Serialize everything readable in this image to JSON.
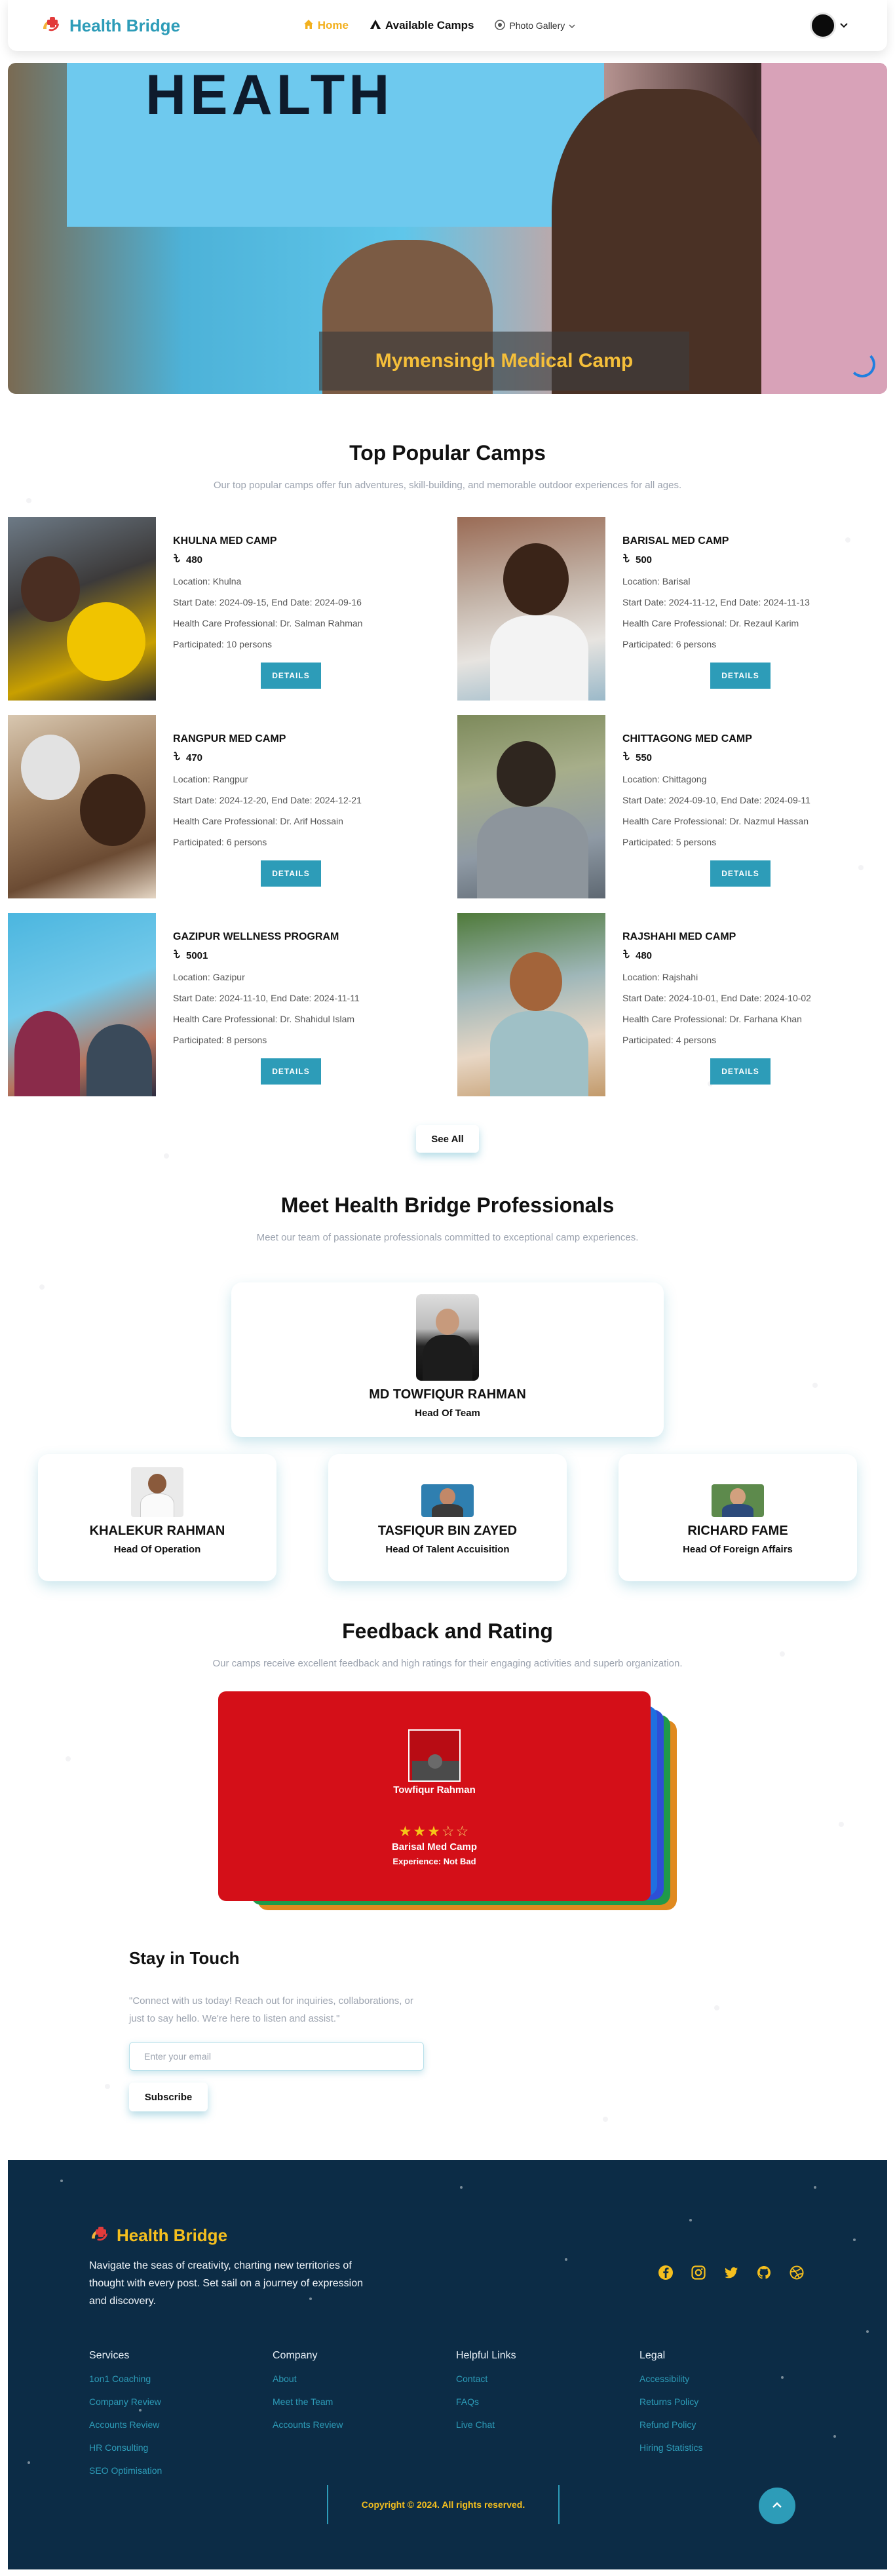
{
  "navbar": {
    "brand": "Health Bridge",
    "links": [
      {
        "label": "Home",
        "icon": "home-icon",
        "active": true
      },
      {
        "label": "Available Camps",
        "icon": "tent-icon",
        "active": false
      },
      {
        "label": "Photo Gallery",
        "icon": "gallery-icon",
        "active": false
      }
    ],
    "colors": {
      "brand": "#2d9cb8",
      "active": "#f2b01e"
    }
  },
  "hero": {
    "banner_text": "HEALTH",
    "caption": "Mymensingh Medical Camp"
  },
  "popular": {
    "title": "Top Popular Camps",
    "subtitle": "Our top popular camps offer fun adventures, skill-building, and memorable outdoor experiences for all ages.",
    "details_label": "DETAILS",
    "see_all_label": "See All",
    "camps": [
      {
        "name": "KHULNA MED CAMP",
        "fee": "480",
        "location": "Location: Khulna",
        "dates": "Start Date: 2024-09-15, End Date: 2024-09-16",
        "professional": "Health Care Professional: Dr. Salman Rahman",
        "participated": "Participated: 10 persons"
      },
      {
        "name": "BARISAL MED CAMP",
        "fee": "500",
        "location": "Location: Barisal",
        "dates": "Start Date: 2024-11-12, End Date: 2024-11-13",
        "professional": "Health Care Professional: Dr. Rezaul Karim",
        "participated": "Participated: 6 persons"
      },
      {
        "name": "RANGPUR MED CAMP",
        "fee": "470",
        "location": "Location: Rangpur",
        "dates": "Start Date: 2024-12-20, End Date: 2024-12-21",
        "professional": "Health Care Professional: Dr. Arif Hossain",
        "participated": "Participated: 6 persons"
      },
      {
        "name": "CHITTAGONG MED CAMP",
        "fee": "550",
        "location": "Location: Chittagong",
        "dates": "Start Date: 2024-09-10, End Date: 2024-09-11",
        "professional": "Health Care Professional: Dr. Nazmul Hassan",
        "participated": "Participated: 5 persons"
      },
      {
        "name": "GAZIPUR WELLNESS PROGRAM",
        "fee": "5001",
        "location": "Location: Gazipur",
        "dates": "Start Date: 2024-11-10, End Date: 2024-11-11",
        "professional": "Health Care Professional: Dr. Shahidul Islam",
        "participated": "Participated: 8 persons"
      },
      {
        "name": "RAJSHAHI MED CAMP",
        "fee": "480",
        "location": "Location: Rajshahi",
        "dates": "Start Date: 2024-10-01, End Date: 2024-10-02",
        "professional": "Health Care Professional: Dr. Farhana Khan",
        "participated": "Participated: 4 persons"
      }
    ]
  },
  "professionals": {
    "title": "Meet Health Bridge Professionals",
    "subtitle": "Meet our team of passionate professionals committed to exceptional camp experiences.",
    "lead": {
      "name": "MD TOWFIQUR RAHMAN",
      "role": "Head Of Team"
    },
    "team": [
      {
        "name": "KHALEKUR RAHMAN",
        "role": "Head Of Operation"
      },
      {
        "name": "TASFIQUR BIN ZAYED",
        "role": "Head Of Talent Accuisition"
      },
      {
        "name": "RICHARD FAME",
        "role": "Head Of Foreign Affairs"
      }
    ]
  },
  "feedback": {
    "title": "Feedback and Rating",
    "subtitle": "Our camps receive excellent feedback and high ratings for their engaging activities and superb organization.",
    "card": {
      "name": "Towfiqur Rahman",
      "rating": 3,
      "max_rating": 5,
      "camp": "Barisal Med Camp",
      "experience": "Experience: Not Bad"
    },
    "colors": {
      "card": "#d40f18",
      "stack": [
        "#1f6fe0",
        "#2d4fd6",
        "#1f9a4a",
        "#e08a1f"
      ]
    }
  },
  "newsletter": {
    "title": "Stay in Touch",
    "text": "\"Connect with us today! Reach out for inquiries, collaborations, or just to say hello. We're here to listen and assist.\"",
    "placeholder": "Enter your email",
    "button": "Subscribe"
  },
  "footer": {
    "brand": "Health Bridge",
    "about": "Navigate the seas of creativity, charting new territories of thought with every post. Set sail on a journey of expression and discovery.",
    "social": [
      "facebook-icon",
      "instagram-icon",
      "twitter-icon",
      "github-icon",
      "dribbble-icon"
    ],
    "columns": [
      {
        "title": "Services",
        "links": [
          "1on1 Coaching",
          "Company Review",
          "Accounts Review",
          "HR Consulting",
          "SEO Optimisation"
        ]
      },
      {
        "title": "Company",
        "links": [
          "About",
          "Meet the Team",
          "Accounts Review"
        ]
      },
      {
        "title": "Helpful Links",
        "links": [
          "Contact",
          "FAQs",
          "Live Chat"
        ]
      },
      {
        "title": "Legal",
        "links": [
          "Accessibility",
          "Returns Policy",
          "Refund Policy",
          "Hiring Statistics"
        ]
      }
    ],
    "copyright": "Copyright © 2024. All rights reserved.",
    "colors": {
      "background": "#0c2c46",
      "accent": "#f5bf1e",
      "link": "#2d9cb8"
    }
  }
}
